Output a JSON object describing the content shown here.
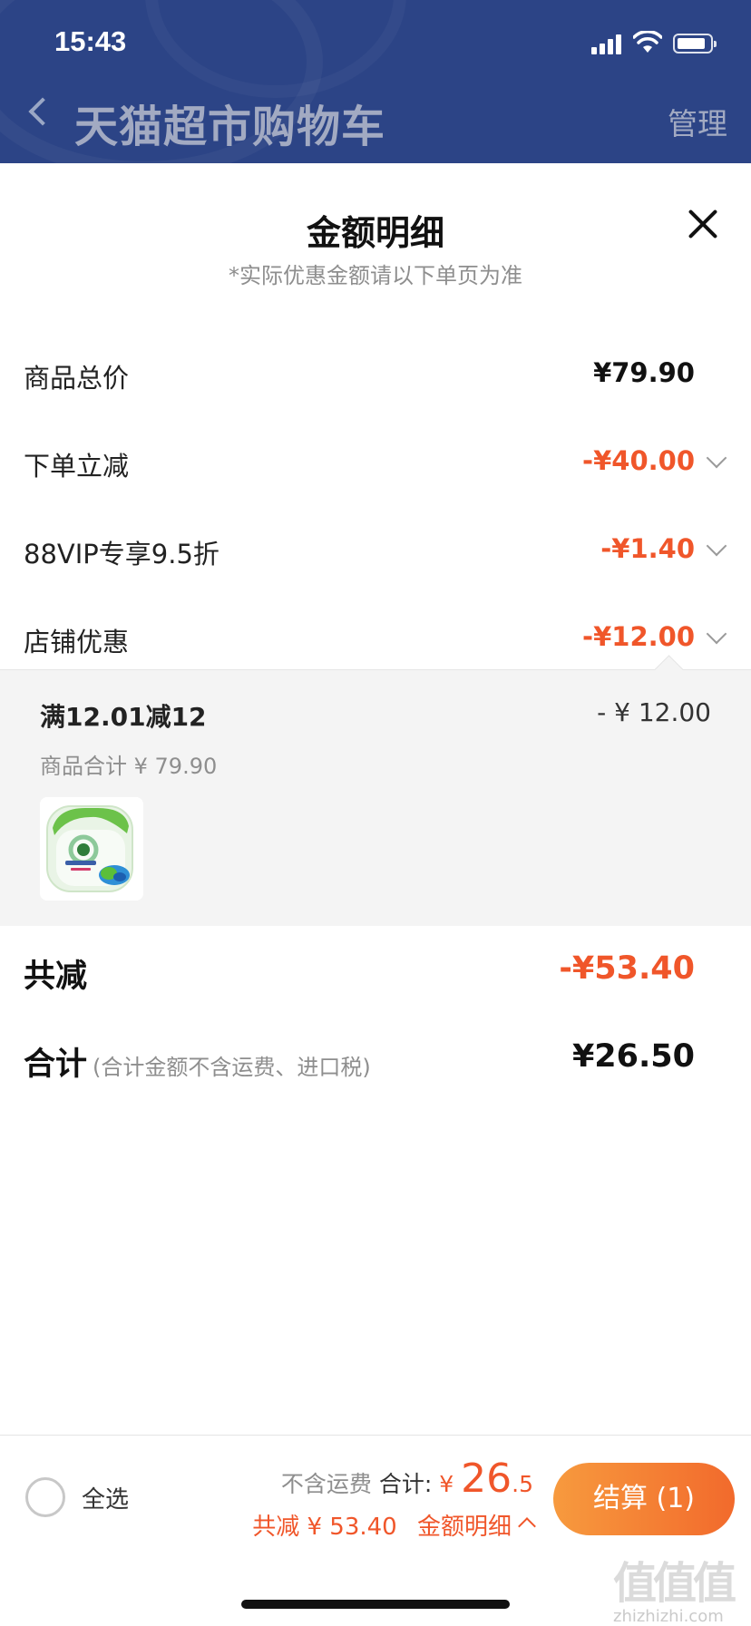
{
  "status_bar": {
    "time": "15:43"
  },
  "header": {
    "title": "天猫超市购物车",
    "manage_label": "管理"
  },
  "sheet": {
    "title": "金额明细",
    "subtitle": "*实际优惠金额请以下单页为准",
    "rows": [
      {
        "label": "商品总价",
        "value": "¥79.90"
      },
      {
        "label": "下单立减",
        "value": "-¥40.00"
      },
      {
        "label": "88VIP专享9.5折",
        "value": "-¥1.40"
      },
      {
        "label": "店铺优惠",
        "value": "-¥12.00"
      }
    ],
    "store_discount_detail": {
      "name": "满12.01减12",
      "amount": "- ¥ 12.00",
      "subtotal": "商品合计 ¥ 79.90",
      "product_image": "detergent-pods-product"
    },
    "total_discount": {
      "label": "共减",
      "value": "-¥53.40"
    },
    "total": {
      "label": "合计",
      "note": "(合计金额不含运费、进口税)",
      "value": "¥26.50"
    }
  },
  "bottom_bar": {
    "select_all_label": "全选",
    "shipping_note": "不含运费",
    "total_label": "合计:",
    "currency": "¥",
    "total_integer": "26",
    "total_decimal": ".5",
    "discount_text": "共减 ¥ 53.40",
    "detail_link": "金额明细",
    "checkout_label": "结算 (1)"
  },
  "watermark": {
    "mark": "值值值",
    "url": "zhizhizhi.com"
  },
  "colors": {
    "header_bg": "#2c4486",
    "accent": "#f0562a",
    "checkout_gradient": [
      "#f79a3e",
      "#f26a2c"
    ]
  }
}
